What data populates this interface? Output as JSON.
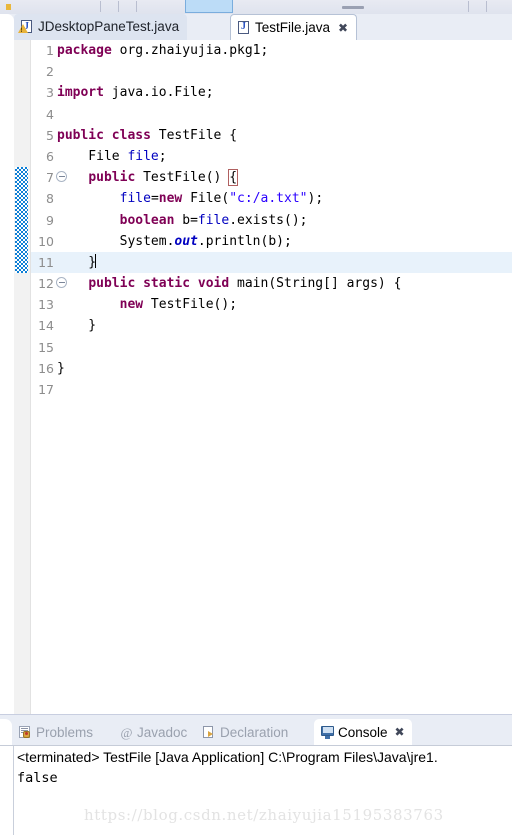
{
  "window": {
    "app": "Eclipse IDE"
  },
  "toolbar": {
    "icons": [
      "save-icon",
      "print-icon",
      "run-icon",
      "debug-icon",
      "separator"
    ]
  },
  "editor_tabs": [
    {
      "label": "JDesktopPaneTest.java",
      "icon": "java-file-warning-icon",
      "active": false,
      "closable": false
    },
    {
      "label": "TestFile.java",
      "icon": "java-file-icon",
      "active": true,
      "closable": true,
      "close_glyph": "✖"
    }
  ],
  "editor": {
    "font_size": "13px",
    "current_line": 11,
    "change_bar_lines": [
      7,
      8,
      9,
      10,
      11
    ],
    "lines": [
      {
        "n": "1",
        "fold": false,
        "indent": 0,
        "tokens": [
          {
            "t": "package",
            "c": "kw"
          },
          {
            "t": " org.zhaiyujia.pkg1;",
            "c": "pln"
          }
        ]
      },
      {
        "n": "2",
        "fold": false,
        "indent": 0,
        "tokens": []
      },
      {
        "n": "3",
        "fold": false,
        "indent": 0,
        "tokens": [
          {
            "t": "import",
            "c": "kw"
          },
          {
            "t": " java.io.File;",
            "c": "pln"
          }
        ]
      },
      {
        "n": "4",
        "fold": false,
        "indent": 0,
        "tokens": []
      },
      {
        "n": "5",
        "fold": false,
        "indent": 0,
        "tokens": [
          {
            "t": "public class",
            "c": "kw"
          },
          {
            "t": " TestFile {",
            "c": "pln"
          }
        ]
      },
      {
        "n": "6",
        "fold": false,
        "indent": 0,
        "tokens": [
          {
            "t": "    File ",
            "c": "pln"
          },
          {
            "t": "file",
            "c": "fld"
          },
          {
            "t": ";",
            "c": "pln"
          }
        ]
      },
      {
        "n": "7",
        "fold": true,
        "indent": 0,
        "tokens": [
          {
            "t": "    ",
            "c": "pln"
          },
          {
            "t": "public",
            "c": "kw"
          },
          {
            "t": " TestFile() ",
            "c": "pln"
          },
          {
            "t": "{",
            "c": "brbox"
          }
        ]
      },
      {
        "n": "8",
        "fold": false,
        "indent": 0,
        "tokens": [
          {
            "t": "        ",
            "c": "pln"
          },
          {
            "t": "file",
            "c": "fld"
          },
          {
            "t": "=",
            "c": "pln"
          },
          {
            "t": "new",
            "c": "kw"
          },
          {
            "t": " File(",
            "c": "pln"
          },
          {
            "t": "\"c:/a.txt\"",
            "c": "str"
          },
          {
            "t": ");",
            "c": "pln"
          }
        ]
      },
      {
        "n": "9",
        "fold": false,
        "indent": 0,
        "tokens": [
          {
            "t": "        ",
            "c": "pln"
          },
          {
            "t": "boolean",
            "c": "kw"
          },
          {
            "t": " b=",
            "c": "pln"
          },
          {
            "t": "file",
            "c": "fld"
          },
          {
            "t": ".exists();",
            "c": "pln"
          }
        ]
      },
      {
        "n": "10",
        "fold": false,
        "indent": 0,
        "tokens": [
          {
            "t": "        System.",
            "c": "pln"
          },
          {
            "t": "out",
            "c": "sfld"
          },
          {
            "t": ".println(b);",
            "c": "pln"
          }
        ]
      },
      {
        "n": "11",
        "fold": false,
        "indent": 0,
        "tokens": [
          {
            "t": "    }",
            "c": "pln"
          }
        ],
        "caret": true
      },
      {
        "n": "12",
        "fold": true,
        "indent": 0,
        "tokens": [
          {
            "t": "    ",
            "c": "pln"
          },
          {
            "t": "public static void",
            "c": "kw"
          },
          {
            "t": " main(String[] args) {",
            "c": "pln"
          }
        ]
      },
      {
        "n": "13",
        "fold": false,
        "indent": 0,
        "tokens": [
          {
            "t": "        ",
            "c": "pln"
          },
          {
            "t": "new",
            "c": "kw"
          },
          {
            "t": " TestFile();",
            "c": "pln"
          }
        ]
      },
      {
        "n": "14",
        "fold": false,
        "indent": 0,
        "tokens": [
          {
            "t": "    }",
            "c": "pln"
          }
        ]
      },
      {
        "n": "15",
        "fold": false,
        "indent": 0,
        "tokens": []
      },
      {
        "n": "16",
        "fold": false,
        "indent": 0,
        "tokens": [
          {
            "t": "}",
            "c": "pln"
          }
        ]
      },
      {
        "n": "17",
        "fold": false,
        "indent": 0,
        "tokens": []
      }
    ]
  },
  "editor_scrollbar": {
    "left_arrow": "‹"
  },
  "view_tabs": [
    {
      "label": "Problems",
      "icon": "problems-icon",
      "active": false,
      "closable": false
    },
    {
      "label": "Javadoc",
      "icon": "javadoc-at-icon",
      "active": false,
      "closable": false
    },
    {
      "label": "Declaration",
      "icon": "declaration-icon",
      "active": false,
      "closable": false
    },
    {
      "label": "Console",
      "icon": "console-icon",
      "active": true,
      "closable": true,
      "close_glyph": "✖"
    }
  ],
  "console": {
    "terminated_line": "<terminated> TestFile [Java Application] C:\\Program Files\\Java\\jre1.",
    "output": "false"
  },
  "watermark": {
    "text": "https://blog.csdn.net/zhaiyujia15195383763"
  },
  "colors": {
    "keyword": "#7f0055",
    "string": "#2a00ff",
    "field": "#0000c0",
    "current_line_highlight": "#e8f2fb",
    "change_bar": "#0d7fd6",
    "tab_bar_bg": "#e9edf5",
    "inactive_tab_bg": "#dde4f0"
  }
}
